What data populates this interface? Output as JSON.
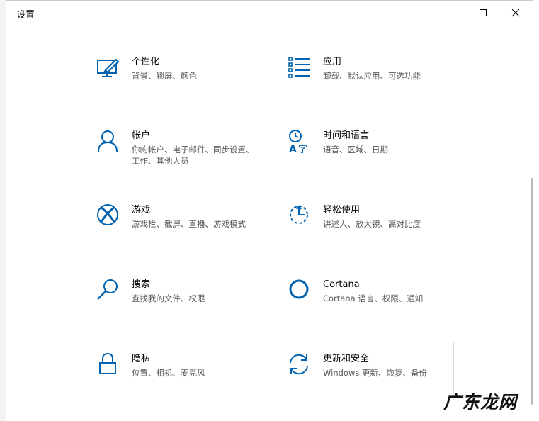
{
  "window": {
    "title": "设置"
  },
  "tiles": [
    {
      "title": "个性化",
      "desc": "背景、锁屏、颜色",
      "icon": "personalization-icon"
    },
    {
      "title": "应用",
      "desc": "卸载、默认应用、可选功能",
      "icon": "apps-list-icon"
    },
    {
      "title": "帐户",
      "desc": "你的帐户、电子邮件、同步设置、工作、其他人员",
      "icon": "account-person-icon"
    },
    {
      "title": "时间和语言",
      "desc": "语音、区域、日期",
      "icon": "time-language-icon"
    },
    {
      "title": "游戏",
      "desc": "游戏栏、截屏、直播、游戏模式",
      "icon": "xbox-icon"
    },
    {
      "title": "轻松使用",
      "desc": "讲述人、放大镜、高对比度",
      "icon": "ease-of-access-icon"
    },
    {
      "title": "搜索",
      "desc": "查找我的文件、权限",
      "icon": "search-magnifier-icon"
    },
    {
      "title": "Cortana",
      "desc": "Cortana 语言、权限、通知",
      "icon": "cortana-circle-icon"
    },
    {
      "title": "隐私",
      "desc": "位置、相机、麦克风",
      "icon": "privacy-lock-icon"
    },
    {
      "title": "更新和安全",
      "desc": "Windows 更新、恢复、备份",
      "icon": "update-sync-icon"
    }
  ],
  "watermark": "广东龙网",
  "colors": {
    "accent": "#0063b1",
    "text": "#000000",
    "subtext": "#595959"
  }
}
